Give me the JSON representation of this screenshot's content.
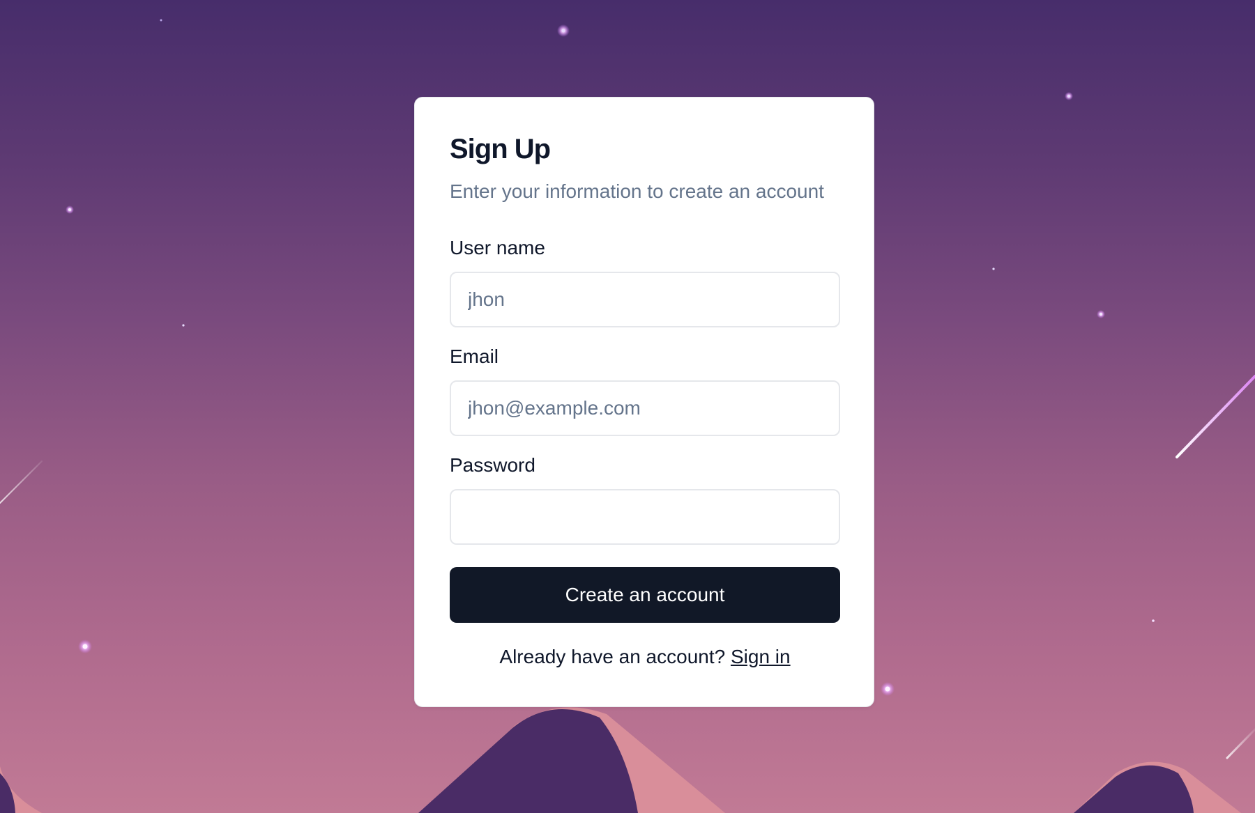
{
  "form": {
    "title": "Sign Up",
    "subtitle": "Enter your information to create an account",
    "username_label": "User name",
    "username_placeholder": "jhon",
    "email_label": "Email",
    "email_placeholder": "jhon@example.com",
    "password_label": "Password",
    "password_placeholder": "",
    "submit_label": "Create an account",
    "signin_prompt": "Already have an account?",
    "signin_link": "Sign in"
  },
  "colors": {
    "sky_top": "#472d6b",
    "sky_bottom": "#c17a95",
    "mountain_dark": "#4a2c66",
    "mountain_light": "#d98e9a",
    "button_bg": "#111827",
    "muted_text": "#64748b"
  }
}
